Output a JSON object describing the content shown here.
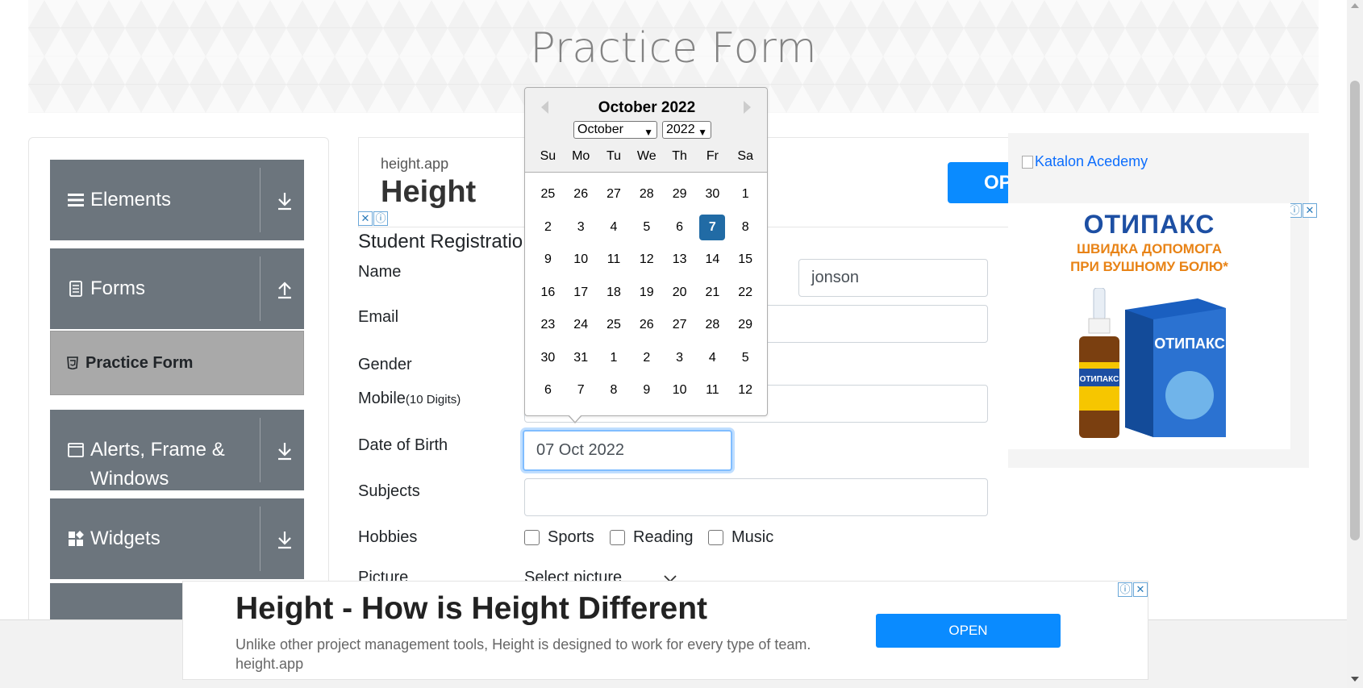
{
  "header": {
    "title": "Practice Form"
  },
  "sidebar": {
    "groups": [
      {
        "label": "Elements",
        "icon": "hamburger-icon",
        "arrow": "download-arrow-icon"
      },
      {
        "label": "Forms",
        "icon": "document-icon",
        "arrow": "upload-arrow-icon"
      },
      {
        "label": "Alerts, Frame & Windows",
        "icon": "window-icon",
        "arrow": "download-arrow-icon"
      },
      {
        "label": "Widgets",
        "icon": "widgets-icon",
        "arrow": "download-arrow-icon"
      }
    ],
    "active_item": {
      "label": "Practice Form",
      "icon": "html5-icon"
    }
  },
  "ad_top": {
    "domain": "height.app",
    "brand": "Height",
    "open_label": "OPE"
  },
  "form": {
    "title": "Student Registratio",
    "labels": {
      "name": "Name",
      "email": "Email",
      "gender": "Gender",
      "mobile": "Mobile",
      "mobile_hint": "(10 Digits)",
      "dob": "Date of Birth",
      "subjects": "Subjects",
      "hobbies": "Hobbies",
      "picture": "Picture"
    },
    "last_name_value": "jonson",
    "dob_value": "07 Oct 2022",
    "subjects_value": "",
    "hobbies": [
      "Sports",
      "Reading",
      "Music"
    ],
    "picture_select": "Select picture"
  },
  "calendar": {
    "month_year": "October 2022",
    "month_select": "October",
    "year_select": "2022",
    "weekdays": [
      "Su",
      "Mo",
      "Tu",
      "We",
      "Th",
      "Fr",
      "Sa"
    ],
    "weeks": [
      [
        "25",
        "26",
        "27",
        "28",
        "29",
        "30",
        "1"
      ],
      [
        "2",
        "3",
        "4",
        "5",
        "6",
        "7",
        "8"
      ],
      [
        "9",
        "10",
        "11",
        "12",
        "13",
        "14",
        "15"
      ],
      [
        "16",
        "17",
        "18",
        "19",
        "20",
        "21",
        "22"
      ],
      [
        "23",
        "24",
        "25",
        "26",
        "27",
        "28",
        "29"
      ],
      [
        "30",
        "31",
        "1",
        "2",
        "3",
        "4",
        "5"
      ],
      [
        "6",
        "7",
        "8",
        "9",
        "10",
        "11",
        "12"
      ]
    ],
    "selected": "7",
    "accent": "#216ba5"
  },
  "ad_right": {
    "image_alt": "Katalon Acedemy",
    "otipax_title": "ОТИПАКС",
    "otipax_sub_1": "ШВИДКА ДОПОМОГА",
    "otipax_sub_2": "ПРИ ВУШНОМУ БОЛЮ*",
    "pack_label": "ОТИПАКС",
    "bottle_label": "ОТИПАКС"
  },
  "ad_bottom": {
    "title": "Height - How is Height Different",
    "text": "Unlike other project management tools, Height is designed to work for every type of team. height.app",
    "open_label": "OPEN"
  },
  "colors": {
    "menu_bg": "#6c757d",
    "active_bg": "#a9a9a9",
    "primary": "#0a8bff"
  }
}
